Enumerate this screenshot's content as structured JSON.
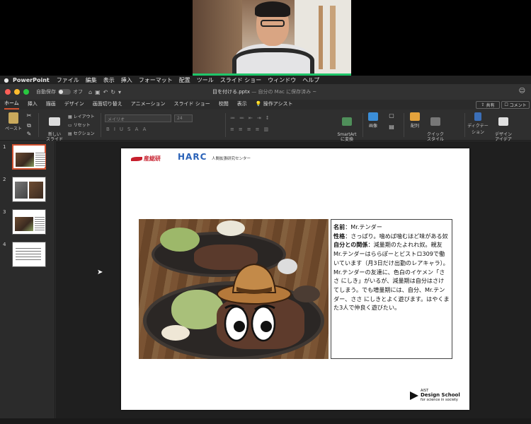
{
  "menubar": {
    "app": "PowerPoint",
    "items": [
      "ファイル",
      "編集",
      "表示",
      "挿入",
      "フォーマット",
      "配置",
      "ツール",
      "スライド ショー",
      "ウィンドウ",
      "ヘルプ"
    ]
  },
  "titlebar": {
    "autosave_label": "自動保存",
    "autosave_state": "オフ",
    "doc_name": "目を付ける.pptx",
    "doc_status": "— 自分の Mac に保存済み ~"
  },
  "ribbon_tabs": [
    "ホーム",
    "挿入",
    "描画",
    "デザイン",
    "画面切り替え",
    "アニメーション",
    "スライド ショー",
    "校閲",
    "表示"
  ],
  "active_tab": "ホーム",
  "assist_label": "操作アシスト",
  "share_label": "共有",
  "comment_label": "コメント",
  "ribbon": {
    "paste": "ペースト",
    "new_slide": "新しい\nスライド",
    "layout": "レイアウト",
    "reset": "リセット",
    "section": "セクション",
    "font_name": "メイリオ",
    "font_size": "24",
    "smartart": "SmartArt\nに変換",
    "image": "画像",
    "arrange": "配列",
    "quick_style": "クイック\nスタイル",
    "dictation": "ディクテーション",
    "design_ideas": "デザイン\nアイデア"
  },
  "thumbnails": [
    {
      "num": "1",
      "selected": true
    },
    {
      "num": "2",
      "selected": false
    },
    {
      "num": "3",
      "selected": false
    },
    {
      "num": "4",
      "selected": false
    }
  ],
  "slide": {
    "logo_sanso": "産総研",
    "logo_harc": "HARC",
    "logo_harc_sub": "人間拡張研究センター",
    "ads_small": "AIST",
    "ads_big": "Design School",
    "ads_tagline": "for science in society",
    "textbox": {
      "name_label": "名前",
      "name_value": "：Mr.テンダー",
      "trait_label": "性格",
      "trait_value": "：さっぱり。噛めば噛むほど味がある奴",
      "relation_label": "自分との関係",
      "relation_value": "：減量期のたよれれ奴。親友",
      "para1": "Mr.テンダーはららぽーとビストロ309で働いています（月3日だけ出勤のレアキャラ）。",
      "para2": "Mr.テンダーの友達に、色白のイケメン「ささ にしき」がいるが、減量期は自分はさけてしまう。でも増量期には、自分、Mr.テンダー、ささ にしきとよく遊びます。はやくまた3人で仲良く遊びたい。"
    }
  },
  "colors": {
    "accent_tab": "#d35230",
    "speaker_border": "#1fc66a",
    "harc_blue": "#2a62b8",
    "sanso_red": "#c71f2d"
  }
}
